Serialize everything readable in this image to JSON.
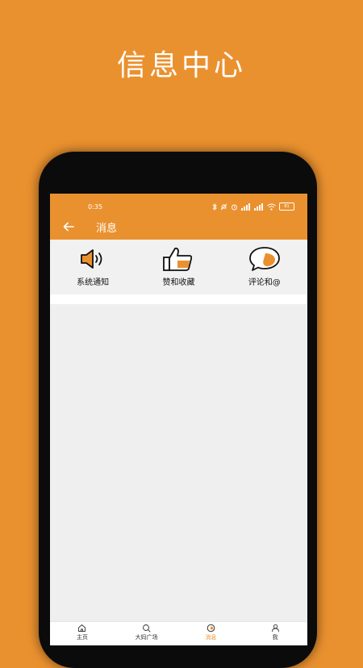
{
  "promo": {
    "title": "信息中心"
  },
  "status_bar": {
    "time": "0:35",
    "battery": "81"
  },
  "header": {
    "title": "消息"
  },
  "categories": [
    {
      "label": "系统通知",
      "icon": "speaker-icon"
    },
    {
      "label": "赞和收藏",
      "icon": "thumbs-up-icon"
    },
    {
      "label": "评论和@",
      "icon": "chat-bubble-icon"
    }
  ],
  "tabs": [
    {
      "label": "主页",
      "icon": "home-icon",
      "active": false
    },
    {
      "label": "大妈广场",
      "icon": "search-icon",
      "active": false
    },
    {
      "label": "消息",
      "icon": "message-icon",
      "active": true
    },
    {
      "label": "我",
      "icon": "user-icon",
      "active": false
    }
  ],
  "colors": {
    "accent": "#EA912F",
    "background": "#efefef",
    "text": "#111111"
  }
}
